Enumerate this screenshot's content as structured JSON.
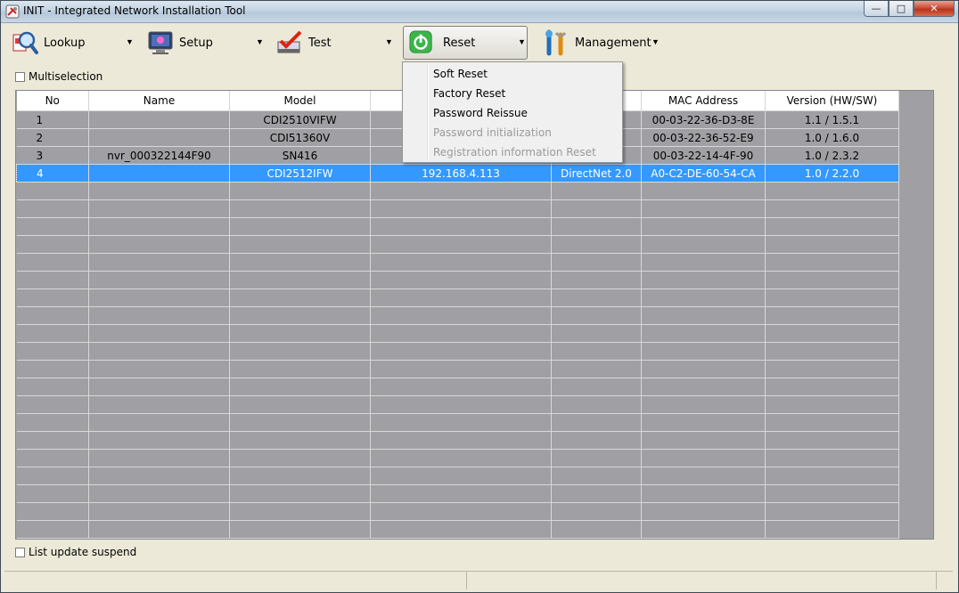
{
  "window": {
    "title": "INIT - Integrated Network Installation Tool",
    "min_glyph": "—",
    "max_glyph": "□",
    "close_glyph": "✕"
  },
  "toolbar": {
    "items": [
      {
        "label": "Lookup",
        "icon": "magnifier-icon",
        "arrow": "▼"
      },
      {
        "label": "Setup",
        "icon": "monitor-settings-icon",
        "arrow": "▼"
      },
      {
        "label": "Test",
        "icon": "checkmark-icon",
        "arrow": "▼"
      },
      {
        "label": "Reset",
        "icon": "power-icon",
        "arrow": "▼"
      },
      {
        "label": "Management",
        "icon": "tools-icon",
        "arrow": "▼"
      }
    ]
  },
  "multiselection": {
    "label": "Multiselection",
    "checked": false
  },
  "table": {
    "columns": [
      "No",
      "Name",
      "Model",
      "",
      "",
      "MAC Address",
      "Version (HW/SW)"
    ],
    "rows": [
      {
        "no": "1",
        "name": "",
        "model": "CDI2510VIFW",
        "ip": "",
        "protocol": "",
        "mac": "00-03-22-36-D3-8E",
        "version": "1.1 / 1.5.1"
      },
      {
        "no": "2",
        "name": "",
        "model": "CDI51360V",
        "ip": "",
        "protocol": "",
        "mac": "00-03-22-36-52-E9",
        "version": "1.0 / 1.6.0"
      },
      {
        "no": "3",
        "name": "nvr_000322144F90",
        "model": "SN416",
        "ip": "",
        "protocol": "",
        "mac": "00-03-22-14-4F-90",
        "version": "1.0 / 2.3.2"
      },
      {
        "no": "4",
        "name": "",
        "model": "CDI2512IFW",
        "ip": "192.168.4.113",
        "protocol": "DirectNet 2.0",
        "mac": "A0-C2-DE-60-54-CA",
        "version": "1.0 / 2.2.0"
      }
    ],
    "selected_row": 4
  },
  "reset_menu": {
    "items": [
      {
        "label": "Soft Reset",
        "enabled": true
      },
      {
        "label": "Factory Reset",
        "enabled": true
      },
      {
        "label": "Password Reissue",
        "enabled": true
      },
      {
        "label": "Password initialization",
        "enabled": false
      },
      {
        "label": "Registration information Reset",
        "enabled": false
      }
    ]
  },
  "list_update_suspend": {
    "label": "List update suspend",
    "checked": false
  },
  "colors": {
    "selection": "#3399ff",
    "grid_bg": "#a0a0a4",
    "reset_icon": "#3cb44b"
  }
}
